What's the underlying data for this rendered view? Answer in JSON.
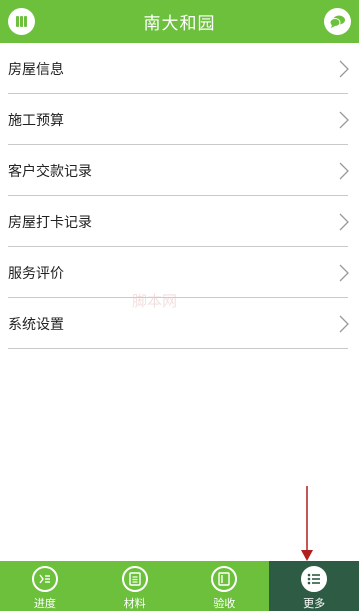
{
  "colors": {
    "brand_green": "#6cc03c",
    "active_tab": "#2e5b43",
    "divider": "#c9c9c9",
    "annotation_red": "#b01e1e"
  },
  "header": {
    "title": "南大和园",
    "left_icon": "book-icon",
    "right_icon": "chat-icon"
  },
  "menu": {
    "items": [
      {
        "label": "房屋信息"
      },
      {
        "label": "施工预算"
      },
      {
        "label": "客户交款记录"
      },
      {
        "label": "房屋打卡记录"
      },
      {
        "label": "服务评价"
      },
      {
        "label": "系统设置"
      }
    ]
  },
  "watermark": {
    "text": "脚本网"
  },
  "tabbar": {
    "tabs": [
      {
        "label": "进度",
        "icon": "progress-icon",
        "active": false
      },
      {
        "label": "材料",
        "icon": "document-icon",
        "active": false
      },
      {
        "label": "验收",
        "icon": "inspection-icon",
        "active": false
      },
      {
        "label": "更多",
        "icon": "list-icon",
        "active": true
      }
    ]
  }
}
